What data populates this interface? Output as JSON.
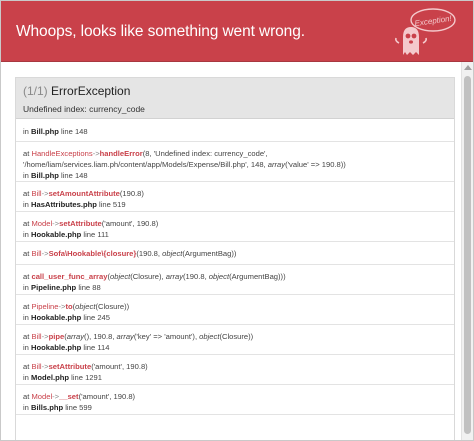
{
  "header": {
    "title": "Whoops, looks like something went wrong.",
    "mascot_label": "Exception!"
  },
  "exception": {
    "count": "(1/1)",
    "name": "ErrorException",
    "message": "Undefined index: currency_code"
  },
  "frames": [
    {
      "kind": "file_only",
      "file": "Bill.php",
      "line": "line 148"
    },
    {
      "kind": "call",
      "class": "HandleExceptions",
      "method": "handleError",
      "args": "8, 'Undefined index: currency_code', '/home/liam/services.liam.ph/content/app/Models/Expense/Bill.php', 148, array('value' => 190.8))",
      "file": "Bill.php",
      "line": "line 148"
    },
    {
      "kind": "call",
      "class": "Bill",
      "method": "setAmountAttribute",
      "args": "190.8)",
      "file": "HasAttributes.php",
      "line": "line 519"
    },
    {
      "kind": "call",
      "class": "Model",
      "method": "setAttribute",
      "args": "'amount', 190.8)",
      "file": "Hookable.php",
      "line": "line 111"
    },
    {
      "kind": "call",
      "class": "Bill",
      "method": "Sofa\\Hookable\\{closure}",
      "args": "190.8, object(ArgumentBag))",
      "file": "",
      "line": ""
    },
    {
      "kind": "call",
      "class": "",
      "method": "call_user_func_array",
      "args": "object(Closure), array(190.8, object(ArgumentBag)))",
      "file": "Pipeline.php",
      "line": "line 88"
    },
    {
      "kind": "call",
      "class": "Pipeline",
      "method": "to",
      "args": "object(Closure))",
      "file": "Hookable.php",
      "line": "line 245"
    },
    {
      "kind": "call",
      "class": "Bill",
      "method": "pipe",
      "args": "array(), 190.8, array('key' => 'amount'), object(Closure))",
      "file": "Hookable.php",
      "line": "line 114"
    },
    {
      "kind": "call",
      "class": "Bill",
      "method": "setAttribute",
      "args": "'amount', 190.8)",
      "file": "Model.php",
      "line": "line 1291"
    },
    {
      "kind": "call",
      "class": "Model",
      "method": "__set",
      "args": "'amount', 190.8)",
      "file": "Bills.php",
      "line": "line 599"
    }
  ],
  "labels": {
    "at": "at",
    "in": "in",
    "arrow": "->"
  },
  "colors": {
    "header_bg": "#c9414a",
    "accent": "#c9414a"
  }
}
